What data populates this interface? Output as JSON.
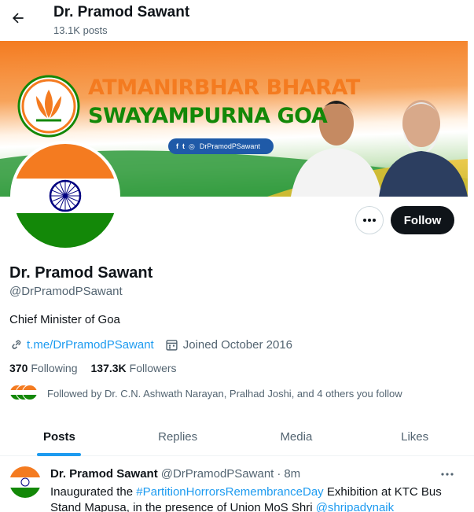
{
  "header": {
    "title": "Dr. Pramod Sawant",
    "post_count": "13.1K posts"
  },
  "banner": {
    "line1": "ATMANIRBHAR BHARAT",
    "line2": "SWAYAMPURNA GOA",
    "social_handle": "DrPramodPSawant"
  },
  "profile": {
    "name": "Dr. Pramod Sawant",
    "handle": "@DrPramodPSawant",
    "bio": "Chief Minister of Goa",
    "link": "t.me/DrPramodPSawant",
    "joined": "Joined October 2016",
    "following_count": "370",
    "following_label": "Following",
    "followers_count": "137.3K",
    "followers_label": "Followers",
    "followed_by": "Followed by Dr. C.N. Ashwath Narayan, Pralhad Joshi, and 4 others you follow"
  },
  "actions": {
    "follow_label": "Follow"
  },
  "tabs": [
    {
      "label": "Posts",
      "active": true
    },
    {
      "label": "Replies",
      "active": false
    },
    {
      "label": "Media",
      "active": false
    },
    {
      "label": "Likes",
      "active": false
    }
  ],
  "tweet": {
    "name": "Dr. Pramod Sawant",
    "handle": "@DrPramodPSawant",
    "separator": "·",
    "time": "8m",
    "text_before": "Inaugurated the ",
    "hashtag": "#PartitionHorrorsRemembranceDay",
    "text_middle": " Exhibition at KTC Bus Stand Mapusa, in the presence of Union MoS Shri ",
    "mention": "@shripadynaik"
  },
  "colors": {
    "accent": "#1d9bf0",
    "text_primary": "#0f1419",
    "text_secondary": "#536471",
    "saffron": "#f47b20",
    "green": "#138808",
    "chakra": "#000080"
  },
  "icons": {
    "back": "arrow-left-icon",
    "more": "ellipsis-icon",
    "link": "link-icon",
    "calendar": "calendar-icon"
  }
}
